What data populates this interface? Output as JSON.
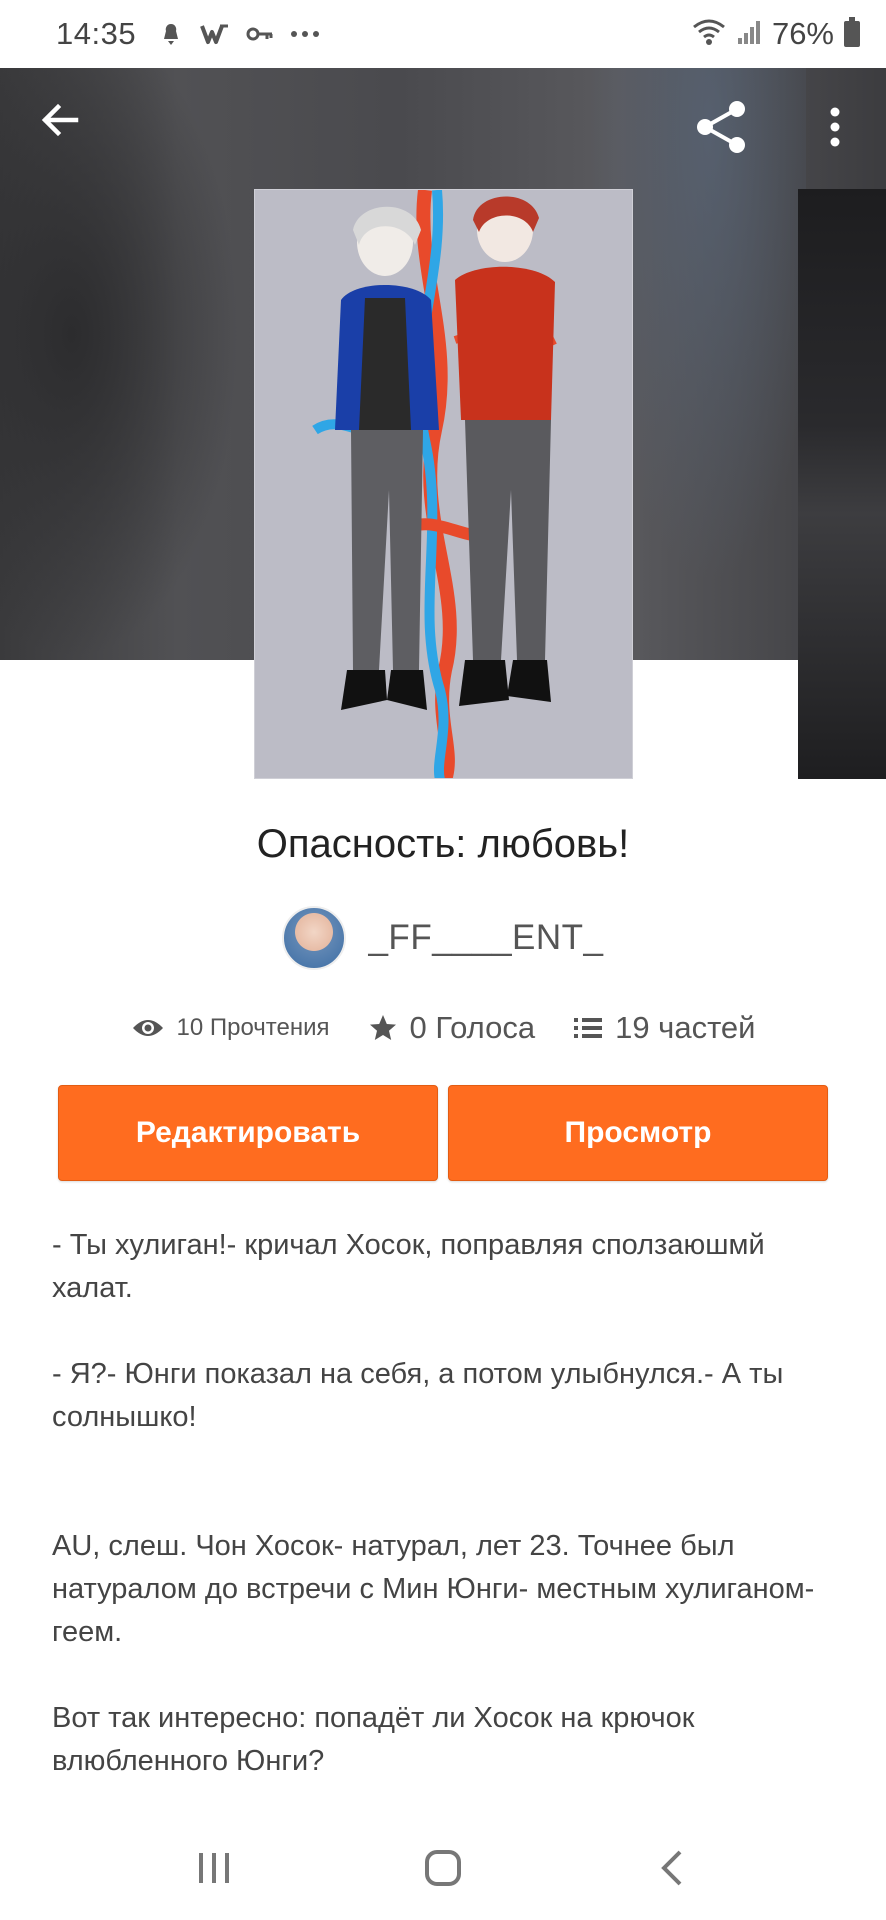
{
  "status_bar": {
    "time": "14:35",
    "battery_text": "76%",
    "icons": [
      "notification-icon",
      "wattpad-icon",
      "key-icon",
      "more-dots-icon",
      "wifi-icon",
      "signal-icon",
      "battery-icon"
    ]
  },
  "toolbar": {
    "back_icon": "arrow-left-icon",
    "share_icon": "share-icon",
    "more_icon": "more-vertical-icon"
  },
  "story": {
    "title": "Опасность: любовь!",
    "author": "_FF____ENT_",
    "stats": {
      "reads": "10 Прочтения",
      "votes": "0 Голоса",
      "parts": "19 частей"
    }
  },
  "actions": {
    "edit_label": "Редактировать",
    "preview_label": "Просмотр"
  },
  "description": {
    "p1": "- Ты хулиган!- кричал Хосок, поправляя сползаюшмй халат.",
    "p2": "- Я?- Юнги показал на себя, а потом улыбнулся.- А ты солнышко!",
    "p3": "AU, слеш. Чон Хосок- натурал, лет 23. Точнее был натуралом до встречи с Мин Юнги- местным хулиганом- геем.",
    "p4": "Вот так интересно: попадёт ли Хосок на крючок влюбленного Юнги?"
  },
  "colors": {
    "accent": "#ff6c1f",
    "hero_bg": "#4a4a4e",
    "text_dark": "#222222",
    "text_muted": "#555555"
  },
  "nav_bar": {
    "items": [
      "recent-apps-icon",
      "home-icon",
      "back-icon"
    ]
  }
}
